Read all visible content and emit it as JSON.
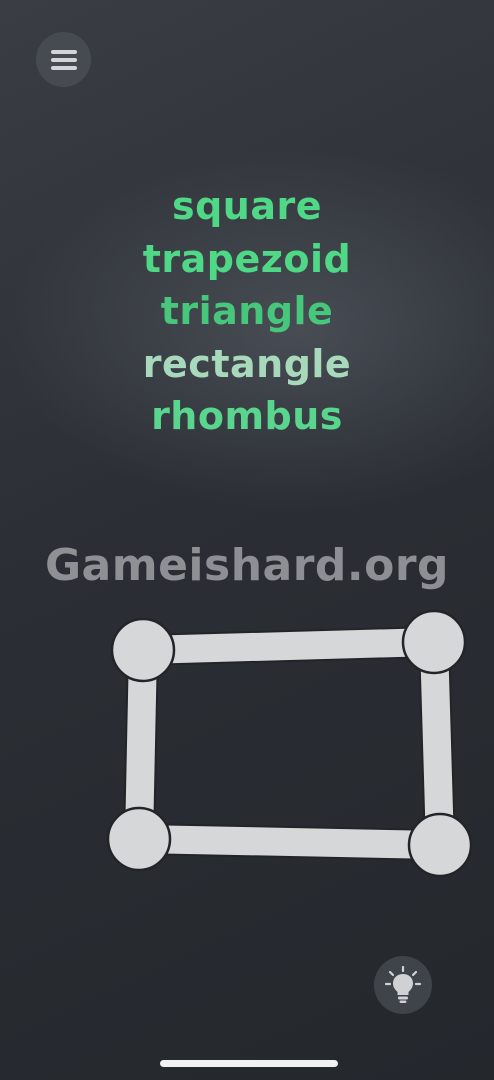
{
  "menu_button": {
    "icon": "hamburger-menu-icon"
  },
  "words": [
    "square",
    "trapezoid",
    "triangle",
    "rectangle",
    "rhombus"
  ],
  "watermark": "Gameishard.org",
  "hint_button": {
    "icon": "lightbulb-icon"
  },
  "colors": {
    "word": "#4fd987",
    "shape": "#d6d7d9",
    "node_outline": "#222428",
    "background": "#2b2f35"
  }
}
